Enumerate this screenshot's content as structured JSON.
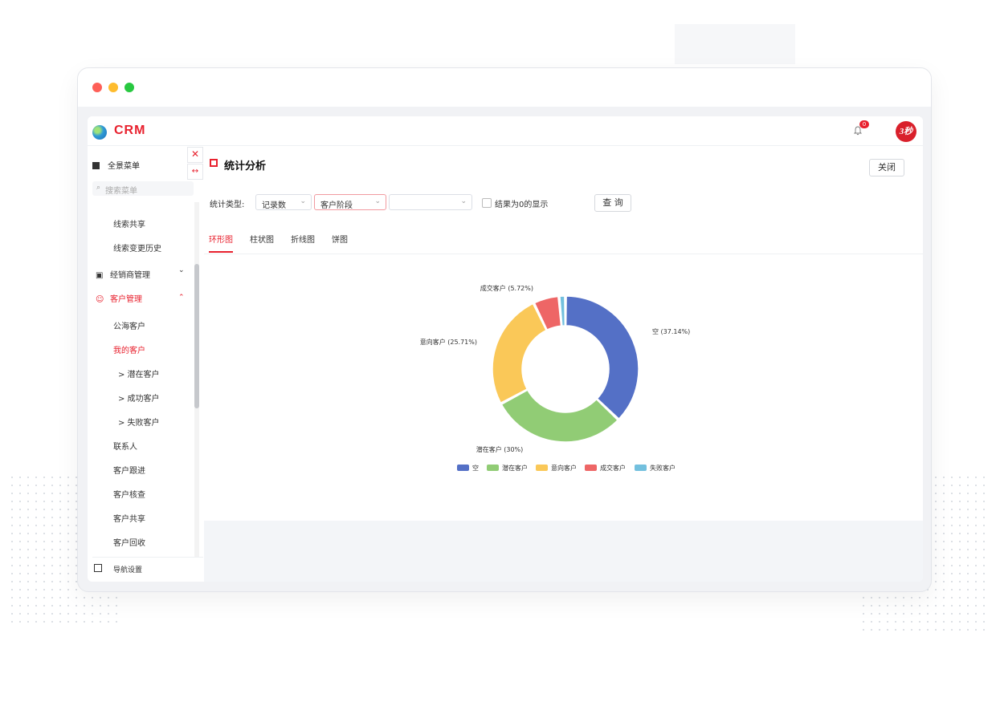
{
  "app": {
    "logo_text": "CRM",
    "notification_count": "0",
    "avatar_text": "3秒"
  },
  "sidebar": {
    "all_menu": "全景菜单",
    "search_placeholder": "搜索菜单",
    "items": [
      {
        "label": "线索共享"
      },
      {
        "label": "线索变更历史"
      }
    ],
    "groups": [
      {
        "label": "经销商管理",
        "chevron": "⌄"
      },
      {
        "label": "客户管理",
        "chevron": "⌃"
      }
    ],
    "customer_items": [
      {
        "label": "公海客户"
      },
      {
        "label": "我的客户"
      },
      {
        "label": "> 潜在客户"
      },
      {
        "label": "> 成功客户"
      },
      {
        "label": "> 失败客户"
      },
      {
        "label": "联系人"
      },
      {
        "label": "客户跟进"
      },
      {
        "label": "客户核查"
      },
      {
        "label": "客户共享"
      },
      {
        "label": "客户回收"
      }
    ],
    "nav_settings": "导航设置"
  },
  "panel": {
    "title": "统计分析",
    "close_label": "关闭"
  },
  "filters": {
    "type_label": "统计类型:",
    "select1": "记录数",
    "select2": "客户阶段",
    "select3": "",
    "show_zero_label": "结果为0的显示",
    "query_label": "查 询"
  },
  "tabs": [
    {
      "label": "环形图"
    },
    {
      "label": "柱状图"
    },
    {
      "label": "折线图"
    },
    {
      "label": "饼图"
    }
  ],
  "colors": {
    "accent": "#e8212e"
  },
  "chart_data": {
    "type": "pie",
    "variant": "donut",
    "categories": [
      "空",
      "潜在客户",
      "意向客户",
      "成交客户",
      "失败客户"
    ],
    "values": [
      37.14,
      30,
      25.71,
      5.72,
      1.43
    ],
    "slice_labels": [
      "空 (37.14%)",
      "潜在客户 (30%)",
      "意向客户 (25.71%)",
      "成交客户 (5.72%)",
      ""
    ],
    "colors": [
      "#5470c6",
      "#91cc75",
      "#fac858",
      "#ee6666",
      "#73c0de"
    ],
    "legend_position": "bottom"
  }
}
